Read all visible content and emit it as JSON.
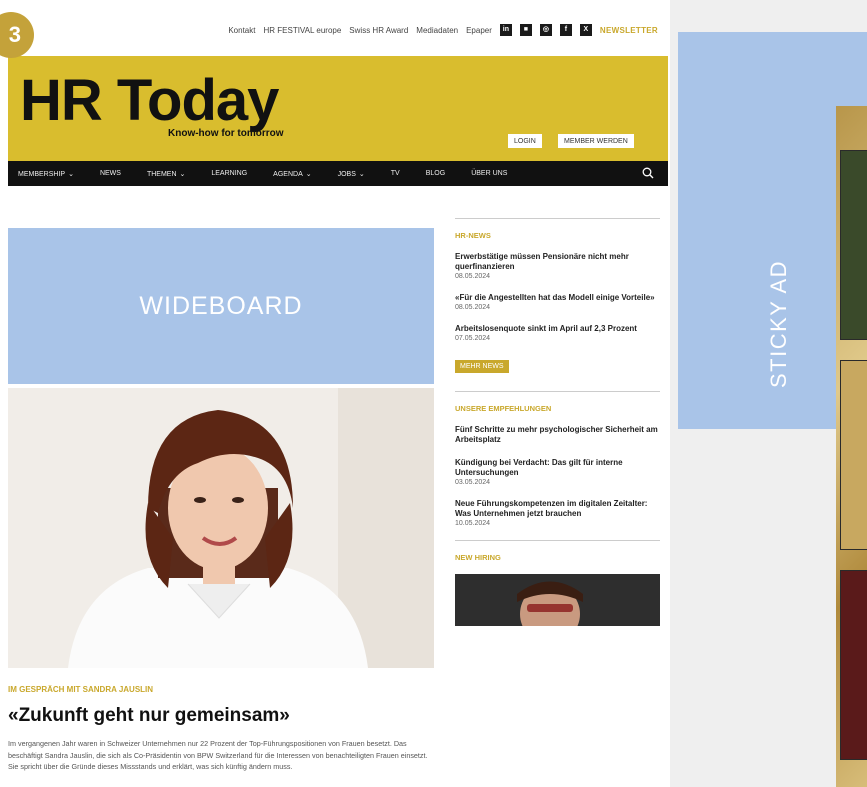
{
  "badge": "3",
  "top_links": [
    "Kontakt",
    "HR FESTIVAL europe",
    "Swiss HR Award",
    "Mediadaten",
    "Epaper"
  ],
  "social_icons": [
    {
      "name": "linkedin-icon",
      "glyph": "in"
    },
    {
      "name": "news-icon",
      "glyph": "■"
    },
    {
      "name": "instagram-icon",
      "glyph": "◎"
    },
    {
      "name": "facebook-icon",
      "glyph": "f"
    },
    {
      "name": "x-icon",
      "glyph": "X"
    }
  ],
  "newsletter": "NEWSLETTER",
  "header": {
    "logo": "HR Today",
    "tagline": "Know-how for tomorrow",
    "login": "LOGIN",
    "member": "MEMBER WERDEN",
    "band_color": "#d9bd2e"
  },
  "nav": {
    "items": [
      {
        "label": "MEMBERSHIP",
        "dropdown": true
      },
      {
        "label": "NEWS",
        "dropdown": false
      },
      {
        "label": "THEMEN",
        "dropdown": true
      },
      {
        "label": "LEARNING",
        "dropdown": false
      },
      {
        "label": "AGENDA",
        "dropdown": true
      },
      {
        "label": "JOBS",
        "dropdown": true
      },
      {
        "label": "TV",
        "dropdown": false
      },
      {
        "label": "BLOG",
        "dropdown": false
      },
      {
        "label": "ÜBER UNS",
        "dropdown": false
      }
    ]
  },
  "wideboard": "WIDEBOARD",
  "article": {
    "kicker": "IM GESPRÄCH MIT SANDRA JAUSLIN",
    "headline": "«Zukunft geht nur gemeinsam»",
    "lead": "Im vergangenen Jahr waren in Schweizer Unternehmen nur 22 Prozent der Top-Führungspositionen von Frauen besetzt. Das beschäftigt Sandra Jauslin, die sich als Co-Präsidentin von BPW Switzerland für die Interessen von benachteiligten Frauen einsetzt. Sie spricht über die Gründe dieses Missstands und erklärt, was sich künftig ändern muss."
  },
  "sidebar": {
    "hr_news_title": "HR-NEWS",
    "hr_news": [
      {
        "title": "Erwerbstätige müssen Pensionäre nicht mehr querfinanzieren",
        "date": "08.05.2024"
      },
      {
        "title": "«Für die Angestellten hat das Modell einige Vorteile»",
        "date": "08.05.2024"
      },
      {
        "title": "Arbeitslosenquote sinkt im April auf 2,3 Prozent",
        "date": "07.05.2024"
      }
    ],
    "more_news": "MEHR NEWS",
    "recommend_title": "UNSERE EMPFEHLUNGEN",
    "recommendations": [
      {
        "title": "Fünf Schritte zu mehr psychologischer Sicherheit am Arbeitsplatz",
        "date": ""
      },
      {
        "title": "Kündigung bei Verdacht: Das gilt für interne Untersuchungen",
        "date": "03.05.2024"
      },
      {
        "title": "Neue Führungskompetenzen im digitalen Zeitalter: Was Unternehmen jetzt brauchen",
        "date": "10.05.2024"
      }
    ],
    "hiring_title": "NEW HIRING"
  },
  "sticky_ad": "STICKY AD",
  "colors": {
    "accent": "#c9a82c",
    "ad_blue": "#a9c4e8",
    "nav_bg": "#111111"
  }
}
